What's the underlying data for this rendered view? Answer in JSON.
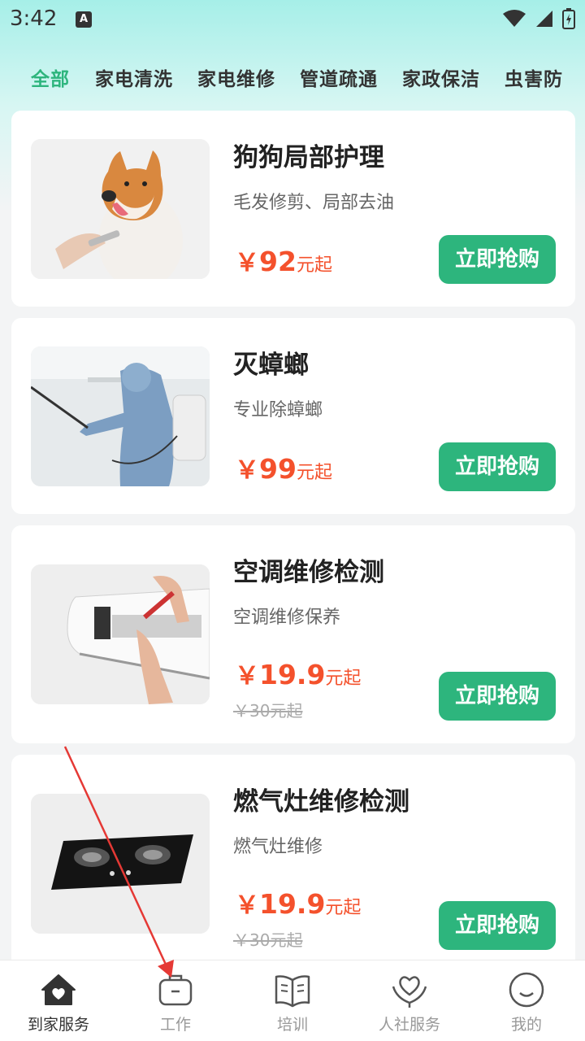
{
  "status_bar": {
    "time": "3:42",
    "notification_badge": "A"
  },
  "tabs": [
    "全部",
    "家电清洗",
    "家电维修",
    "管道疏通",
    "家政保洁",
    "虫害防"
  ],
  "active_tab_index": 0,
  "products": [
    {
      "title": "狗狗局部护理",
      "subtitle": "毛发修剪、局部去油",
      "price_symbol": "￥",
      "price": "92",
      "price_unit": "元起",
      "original_price": "",
      "button": "立即抢购"
    },
    {
      "title": "灭蟑螂",
      "subtitle": "专业除蟑螂",
      "price_symbol": "￥",
      "price": "99",
      "price_unit": "元起",
      "original_price": "",
      "button": "立即抢购"
    },
    {
      "title": "空调维修检测",
      "subtitle": "空调维修保养",
      "price_symbol": "￥",
      "price": "19.9",
      "price_unit": "元起",
      "original_price": "￥30元起",
      "button": "立即抢购"
    },
    {
      "title": "燃气灶维修检测",
      "subtitle": "燃气灶维修",
      "price_symbol": "￥",
      "price": "19.9",
      "price_unit": "元起",
      "original_price": "￥30元起",
      "button": "立即抢购"
    }
  ],
  "nav": [
    {
      "label": "到家服务",
      "icon": "home-heart-icon",
      "active": true
    },
    {
      "label": "工作",
      "icon": "briefcase-icon",
      "active": false
    },
    {
      "label": "培训",
      "icon": "book-icon",
      "active": false
    },
    {
      "label": "人社服务",
      "icon": "heart-hands-icon",
      "active": false
    },
    {
      "label": "我的",
      "icon": "smiley-profile-icon",
      "active": false
    }
  ],
  "colors": {
    "accent": "#2db57d",
    "price": "#f4512c",
    "annotation": "#e53935"
  }
}
